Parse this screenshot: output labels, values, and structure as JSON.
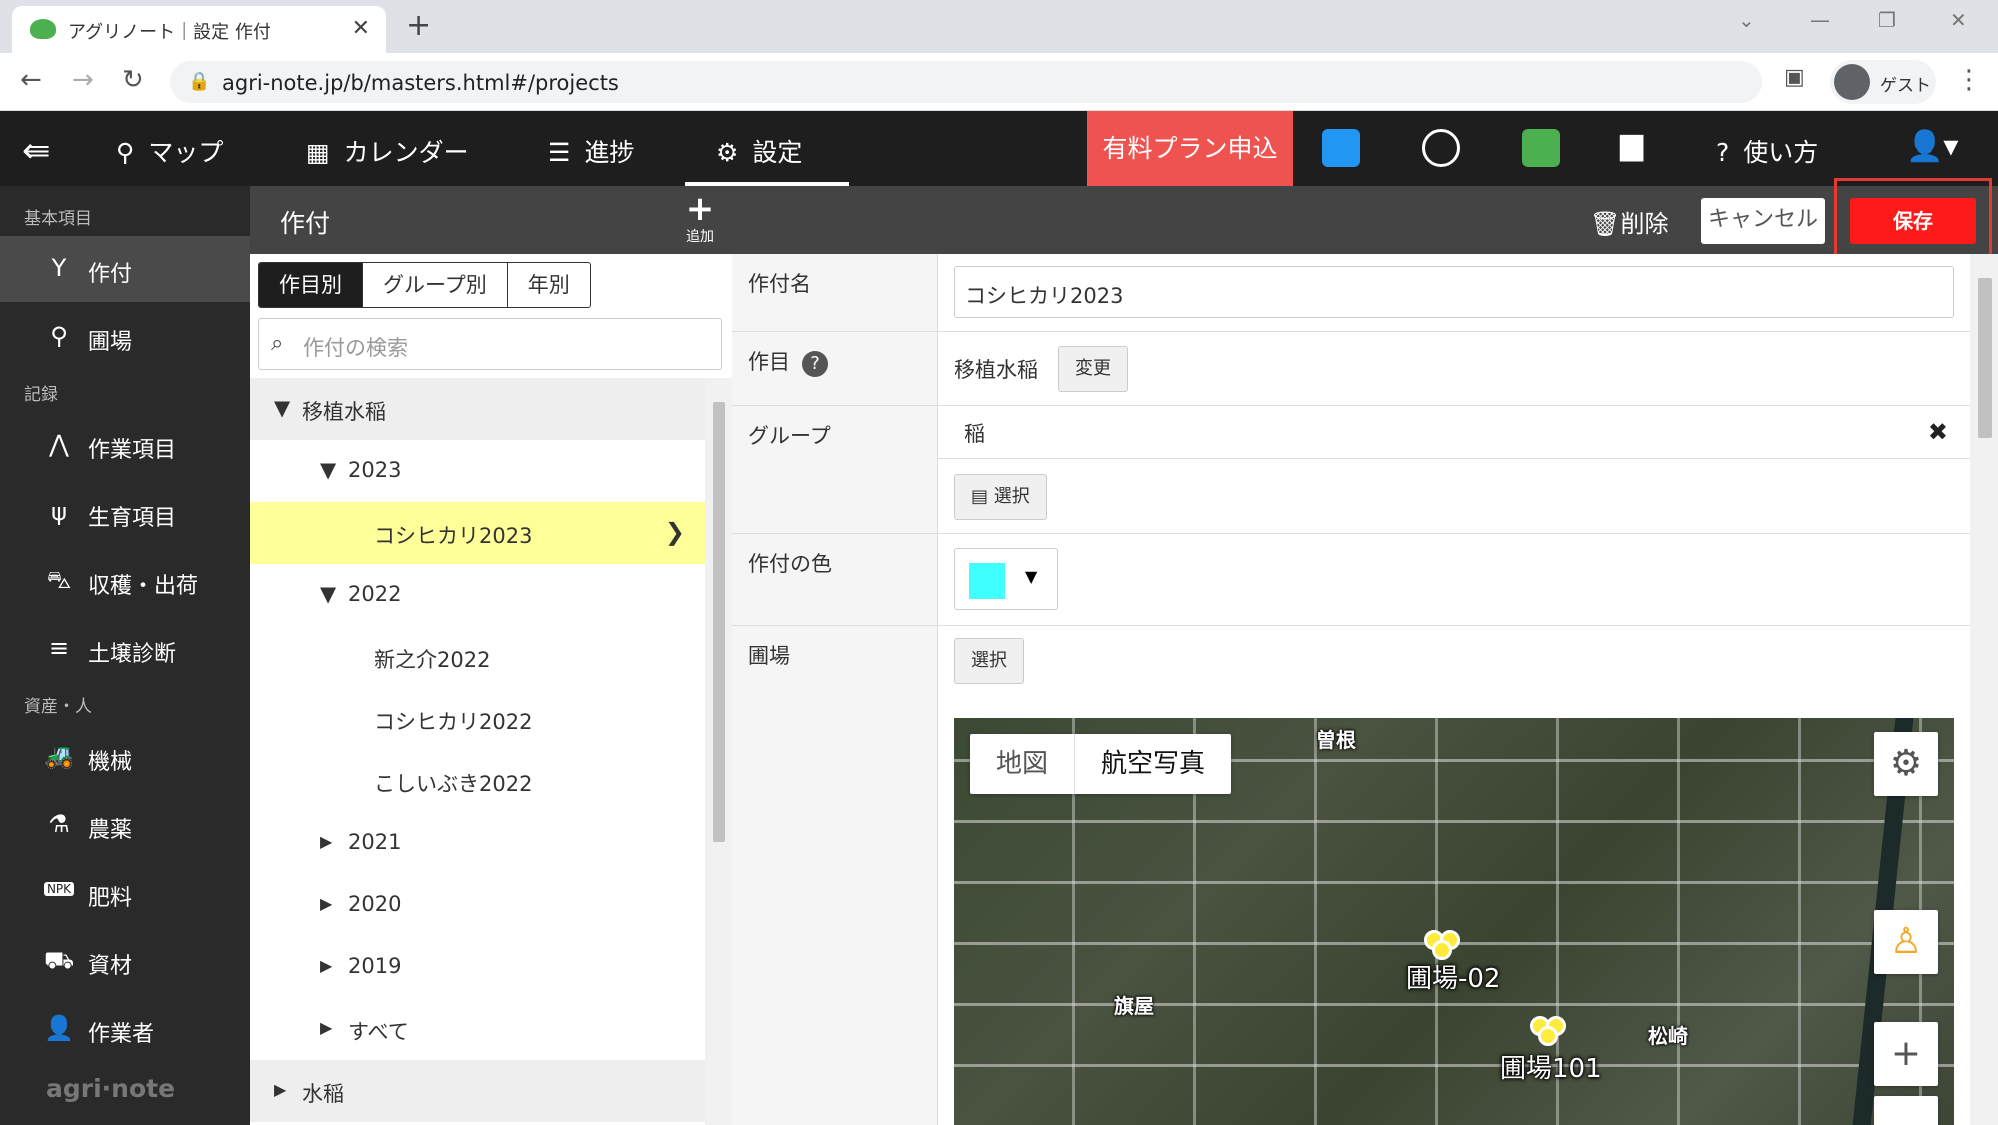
{
  "browser": {
    "tab_title": "アグリノート｜設定 作付",
    "url": "agri-note.jp/b/masters.html#/projects",
    "profile_label": "ゲスト"
  },
  "appbar": {
    "items": [
      {
        "label": "マップ",
        "icon": "map-pin-icon"
      },
      {
        "label": "カレンダー",
        "icon": "calendar-icon"
      },
      {
        "label": "進捗",
        "icon": "checklist-icon"
      },
      {
        "label": "設定",
        "icon": "gear-icon"
      }
    ],
    "premium_label": "有料プラン申込",
    "help_label": "使い方"
  },
  "sidebar": {
    "sections": [
      "基本項目",
      "記録",
      "資産・人"
    ],
    "items": [
      {
        "label": "作付",
        "icon": "sprout-icon"
      },
      {
        "label": "圃場",
        "icon": "location-icon"
      },
      {
        "label": "作業項目",
        "icon": "work-icon"
      },
      {
        "label": "生育項目",
        "icon": "growth-icon"
      },
      {
        "label": "収穫・出荷",
        "icon": "basket-icon"
      },
      {
        "label": "土壌診断",
        "icon": "sliders-icon"
      },
      {
        "label": "機械",
        "icon": "tractor-icon"
      },
      {
        "label": "農薬",
        "icon": "flask-icon"
      },
      {
        "label": "肥料",
        "icon": "npk-icon"
      },
      {
        "label": "資材",
        "icon": "material-icon"
      },
      {
        "label": "作業者",
        "icon": "person-icon"
      }
    ],
    "logo": "agri·note"
  },
  "toolbar": {
    "title": "作付",
    "add_label": "追加",
    "delete_label": "削除",
    "cancel_label": "キャンセル",
    "save_label": "保存"
  },
  "tree": {
    "tabs": [
      "作目別",
      "グループ別",
      "年別"
    ],
    "search_placeholder": "作付の検索",
    "nodes": [
      {
        "label": "移植水稲",
        "arrow": "▼"
      },
      {
        "label": "2023",
        "arrow": "▼"
      },
      {
        "label": "コシヒカリ2023"
      },
      {
        "label": "2022",
        "arrow": "▼"
      },
      {
        "label": "新之介2022"
      },
      {
        "label": "コシヒカリ2022"
      },
      {
        "label": "こしいぶき2022"
      },
      {
        "label": "2021",
        "arrow": "▶"
      },
      {
        "label": "2020",
        "arrow": "▶"
      },
      {
        "label": "2019",
        "arrow": "▶"
      },
      {
        "label": "すべて",
        "arrow": "▶"
      },
      {
        "label": "水稲",
        "arrow": "▶"
      }
    ]
  },
  "form": {
    "name_label": "作付名",
    "name_value": "コシヒカリ2023",
    "crop_label": "作目",
    "crop_value": "移植水稲",
    "change_label": "変更",
    "group_label": "グループ",
    "group_value": "稲",
    "select_label": "選択",
    "color_label": "作付の色",
    "color_value": "#40ffff",
    "field_label": "圃場",
    "field_select_label": "選択"
  },
  "map": {
    "tabs": [
      "地図",
      "航空写真"
    ],
    "places": [
      "曽根",
      "旗屋",
      "松崎"
    ],
    "fields": [
      "圃場-02",
      "圃場101"
    ]
  }
}
